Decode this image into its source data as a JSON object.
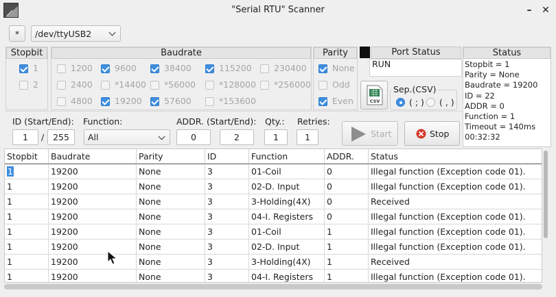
{
  "window": {
    "title": "\"Serial RTU\" Scanner",
    "minimize": "–",
    "close": "✕"
  },
  "port": {
    "refresh_label": "*",
    "selected": "/dev/ttyUSB2"
  },
  "stopbit": {
    "header": "Stopbit",
    "options": [
      {
        "label": "1",
        "checked": true
      },
      {
        "label": "2",
        "checked": false
      }
    ]
  },
  "baudrate": {
    "header": "Baudrate",
    "options": [
      {
        "label": "1200",
        "checked": false
      },
      {
        "label": "9600",
        "checked": true
      },
      {
        "label": "38400",
        "checked": true
      },
      {
        "label": "115200",
        "checked": true
      },
      {
        "label": "230400",
        "checked": false
      },
      {
        "label": "2400",
        "checked": false
      },
      {
        "label": "*14400",
        "checked": false
      },
      {
        "label": "*56000",
        "checked": false
      },
      {
        "label": "*128000",
        "checked": false
      },
      {
        "label": "*256000",
        "checked": false
      },
      {
        "label": "4800",
        "checked": false
      },
      {
        "label": "19200",
        "checked": true
      },
      {
        "label": "57600",
        "checked": true
      },
      {
        "label": "*153600",
        "checked": false
      }
    ]
  },
  "parity": {
    "header": "Parity",
    "options": [
      {
        "label": "None",
        "checked": true
      },
      {
        "label": "Odd",
        "checked": false
      },
      {
        "label": "Even",
        "checked": true
      }
    ]
  },
  "port_status": {
    "header": "Port Status",
    "value": "RUN"
  },
  "csv": {
    "icon_text": "CSV",
    "sep_label": "Sep.(CSV)",
    "option_semicolon": "( ; )",
    "option_comma": "( , )"
  },
  "status": {
    "header": "Status",
    "lines": [
      "Stopbit = 1",
      "Parity = None",
      "Baudrate = 19200",
      "ID = 22",
      "ADDR = 0",
      "Function = 1",
      "Timeout = 140ms",
      "00:32:32"
    ]
  },
  "controls": {
    "id_label": "ID (Start/End):",
    "id_start": "1",
    "id_sep": "/",
    "id_end": "255",
    "function_label": "Function:",
    "function_value": "All",
    "addr_label": "ADDR. (Start/End):",
    "addr_start": "0",
    "addr_end": "2",
    "qty_label": "Qty.:",
    "qty_value": "1",
    "retries_label": "Retries:",
    "retries_value": "1",
    "start_label": "Start",
    "stop_label": "Stop"
  },
  "table": {
    "columns": [
      "Stopbit",
      "Baudrate",
      "Parity",
      "ID",
      "Function",
      "ADDR.",
      "Status"
    ],
    "rows": [
      [
        "1",
        "19200",
        "None",
        "3",
        "01-Coil",
        "0",
        "Illegal function (Exception code 01)."
      ],
      [
        "1",
        "19200",
        "None",
        "3",
        "02-D. Input",
        "0",
        "Illegal function (Exception code 01)."
      ],
      [
        "1",
        "19200",
        "None",
        "3",
        "3-Holding(4X)",
        "0",
        "Received"
      ],
      [
        "1",
        "19200",
        "None",
        "3",
        "04-I. Registers",
        "0",
        "Illegal function (Exception code 01)."
      ],
      [
        "1",
        "19200",
        "None",
        "3",
        "01-Coil",
        "1",
        "Illegal function (Exception code 01)."
      ],
      [
        "1",
        "19200",
        "None",
        "3",
        "02-D. Input",
        "1",
        "Illegal function (Exception code 01)."
      ],
      [
        "1",
        "19200",
        "None",
        "3",
        "3-Holding(4X)",
        "1",
        "Received"
      ],
      [
        "1",
        "19200",
        "None",
        "3",
        "04-I. Registers",
        "1",
        "Illegal function (Exception code 01)."
      ]
    ]
  },
  "colors": {
    "accent": "#3f8ee0",
    "stop_icon": "#d33a2c",
    "csv_icon": "#2e7d4f"
  }
}
